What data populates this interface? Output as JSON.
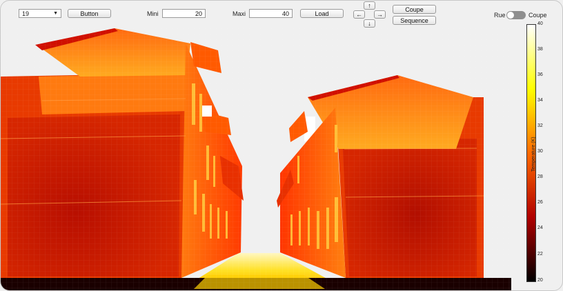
{
  "toolbar": {
    "dropdown_value": "19",
    "button_label": "Button",
    "mini_label": "Mini",
    "mini_value": "20",
    "maxi_label": "Maxi",
    "maxi_value": "40",
    "load_label": "Load",
    "up_arrow": "↑",
    "left_arrow": "←",
    "right_arrow": "→",
    "down_arrow": "↓",
    "coupe_button_label": "Coupe",
    "sequence_label": "Sequence",
    "toggle_left_label": "Rue",
    "toggle_right_label": "Coupe"
  },
  "colorbar": {
    "title": "Temperature (K)",
    "ticks": [
      "40",
      "38",
      "36",
      "34",
      "32",
      "30",
      "28",
      "26",
      "24",
      "22",
      "20"
    ],
    "colors": {
      "max": "#ffffff",
      "high": "#ffff00",
      "mid": "#ff6a00",
      "low": "#b00000",
      "min": "#000000"
    }
  }
}
